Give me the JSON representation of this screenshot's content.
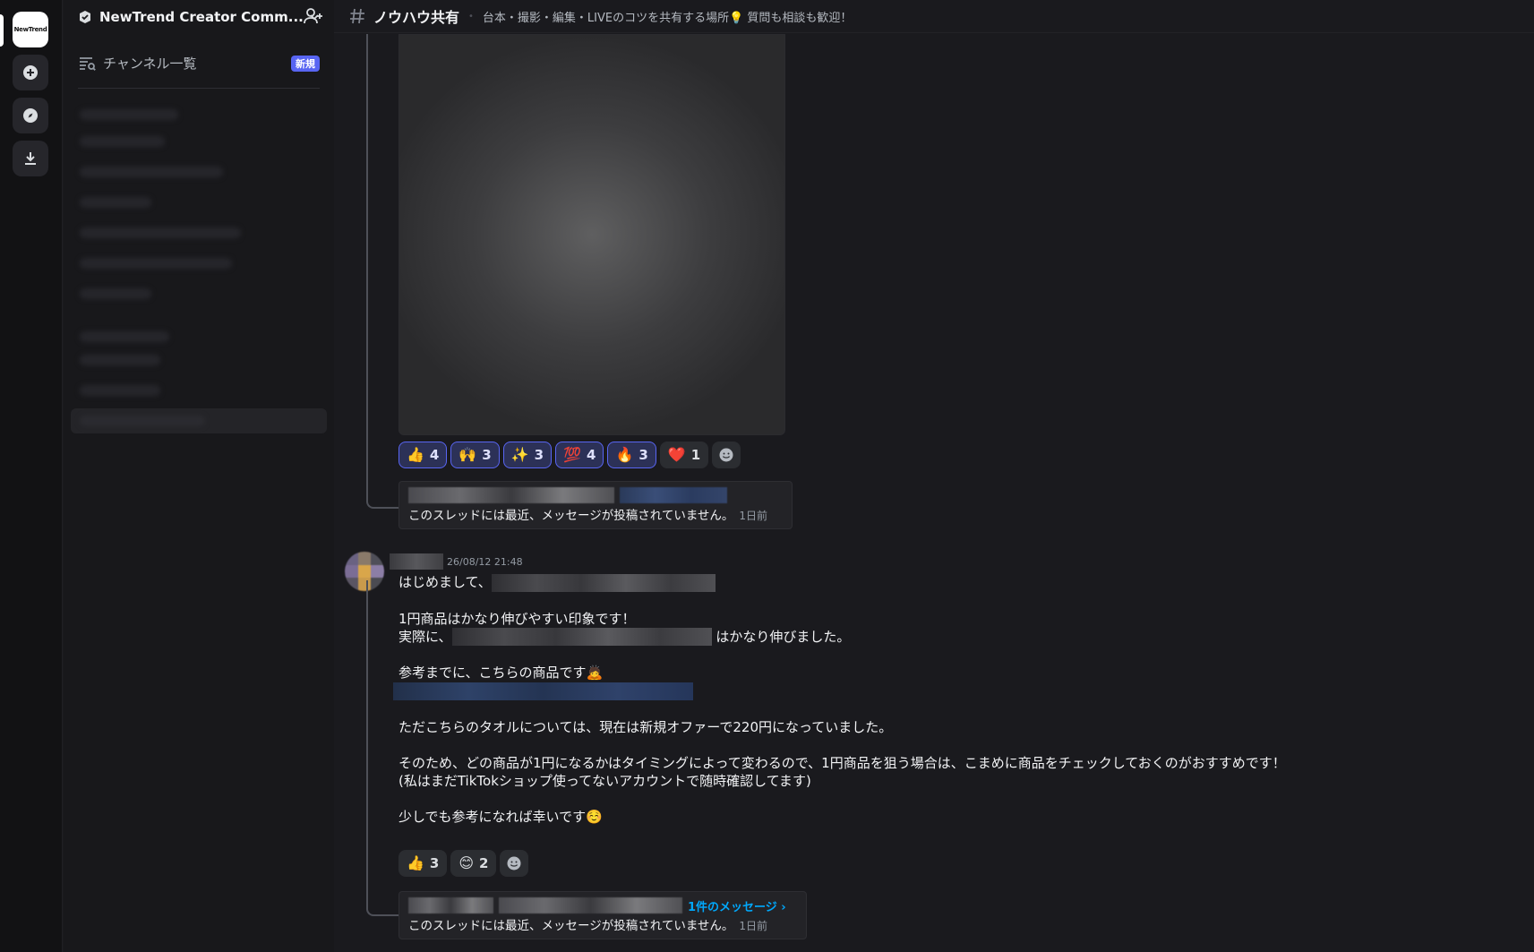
{
  "server": {
    "logo_text": "NewTrend",
    "name": "NewTrend Creator Comm...",
    "channel_list_label": "チャンネル一覧",
    "new_badge": "新規"
  },
  "channel": {
    "name": "ノウハウ共有",
    "topic": "台本・撮影・編集・LIVEのコツを共有する場所💡 質問も相談も歓迎！"
  },
  "post1": {
    "reactions": [
      {
        "emoji": "👍",
        "count": "4",
        "me": true
      },
      {
        "emoji": "🙌",
        "count": "3",
        "me": true
      },
      {
        "emoji": "✨",
        "count": "3",
        "me": true
      },
      {
        "emoji": "💯",
        "count": "4",
        "me": true
      },
      {
        "emoji": "🔥",
        "count": "3",
        "me": true
      },
      {
        "emoji": "❤️",
        "count": "1",
        "me": false
      }
    ],
    "thread_status": "このスレッドには最近、メッセージが投稿されていません。",
    "thread_ago": "1日前"
  },
  "post2": {
    "timestamp": "26/08/12 21:48",
    "lines": {
      "l1": "はじめまして、",
      "l2": "1円商品はかなり伸びやすい印象です！",
      "l3a": "実際に、",
      "l3b": "はかなり伸びました。",
      "l4": "参考までに、こちらの商品です🙇",
      "l5": "ただこちらのタオルについては、現在は新規オファーで220円になっていました。",
      "l6": "そのため、どの商品が1円になるかはタイミングによって変わるので、1円商品を狙う場合は、こまめに商品をチェックしておくのがおすすめです！",
      "l7": "(私はまだTikTokショップ使ってないアカウントで随時確認してます)",
      "l8": "少しでも参考になれば幸いです☺️"
    },
    "reactions": [
      {
        "emoji": "👍",
        "count": "3"
      },
      {
        "emoji": "😊",
        "count": "2"
      }
    ],
    "thread_message_count": "1件のメッセージ ›",
    "thread_status": "このスレッドには最近、メッセージが投稿されていません。",
    "thread_ago": "1日前"
  }
}
